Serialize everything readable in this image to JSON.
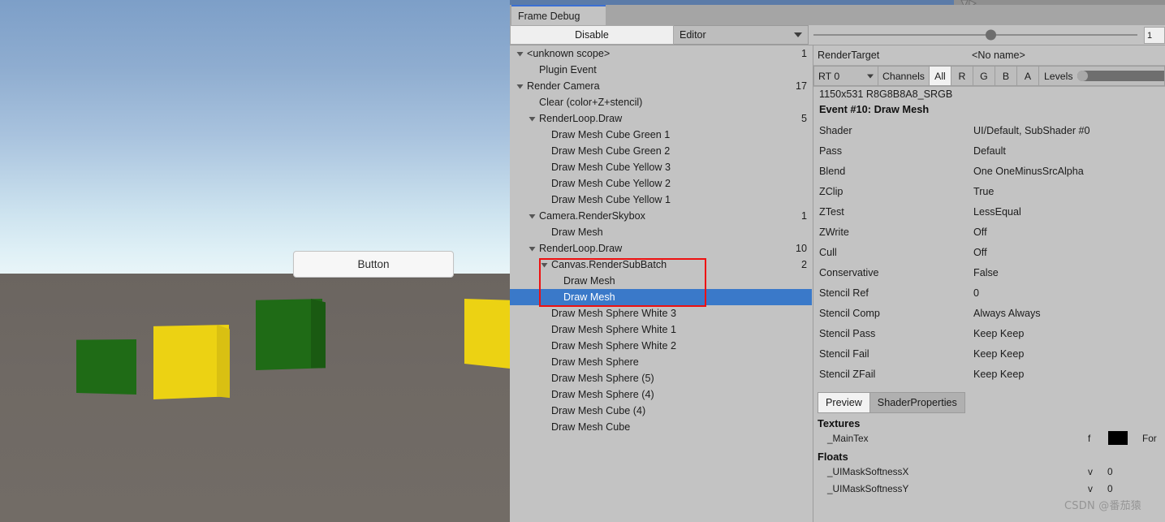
{
  "viewport": {
    "button_label": "Button"
  },
  "window": {
    "tab_label": "Frame Debug"
  },
  "toolbar": {
    "disable_label": "Disable",
    "target_dropdown": "Editor",
    "slider_value": "1"
  },
  "tree": {
    "rows": [
      {
        "label": "<unknown scope>",
        "depth": 0,
        "arrow": "down",
        "count": "1"
      },
      {
        "label": "Plugin Event",
        "depth": 1,
        "arrow": "none",
        "count": ""
      },
      {
        "label": "Render Camera",
        "depth": 0,
        "arrow": "down",
        "count": "17"
      },
      {
        "label": "Clear (color+Z+stencil)",
        "depth": 1,
        "arrow": "none",
        "count": ""
      },
      {
        "label": "RenderLoop.Draw",
        "depth": 1,
        "arrow": "down",
        "count": "5"
      },
      {
        "label": "Draw Mesh Cube Green 1",
        "depth": 2,
        "arrow": "none",
        "count": ""
      },
      {
        "label": "Draw Mesh Cube Green 2",
        "depth": 2,
        "arrow": "none",
        "count": ""
      },
      {
        "label": "Draw Mesh Cube Yellow 3",
        "depth": 2,
        "arrow": "none",
        "count": ""
      },
      {
        "label": "Draw Mesh Cube Yellow 2",
        "depth": 2,
        "arrow": "none",
        "count": ""
      },
      {
        "label": "Draw Mesh Cube Yellow 1",
        "depth": 2,
        "arrow": "none",
        "count": ""
      },
      {
        "label": "Camera.RenderSkybox",
        "depth": 1,
        "arrow": "down",
        "count": "1"
      },
      {
        "label": "Draw Mesh",
        "depth": 2,
        "arrow": "none",
        "count": ""
      },
      {
        "label": "RenderLoop.Draw",
        "depth": 1,
        "arrow": "down",
        "count": "10"
      },
      {
        "label": "Canvas.RenderSubBatch",
        "depth": 2,
        "arrow": "down",
        "count": "2"
      },
      {
        "label": "Draw Mesh",
        "depth": 3,
        "arrow": "none",
        "count": ""
      },
      {
        "label": "Draw Mesh",
        "depth": 3,
        "arrow": "none",
        "count": "",
        "selected": true
      },
      {
        "label": "Draw Mesh Sphere White 3",
        "depth": 2,
        "arrow": "none",
        "count": ""
      },
      {
        "label": "Draw Mesh Sphere White 1",
        "depth": 2,
        "arrow": "none",
        "count": ""
      },
      {
        "label": "Draw Mesh Sphere White 2",
        "depth": 2,
        "arrow": "none",
        "count": ""
      },
      {
        "label": "Draw Mesh Sphere",
        "depth": 2,
        "arrow": "none",
        "count": ""
      },
      {
        "label": "Draw Mesh Sphere (5)",
        "depth": 2,
        "arrow": "none",
        "count": ""
      },
      {
        "label": "Draw Mesh Sphere (4)",
        "depth": 2,
        "arrow": "none",
        "count": ""
      },
      {
        "label": "Draw Mesh Cube (4)",
        "depth": 2,
        "arrow": "none",
        "count": ""
      },
      {
        "label": "Draw Mesh Cube",
        "depth": 2,
        "arrow": "none",
        "count": ""
      }
    ]
  },
  "detail": {
    "render_target_label": "RenderTarget",
    "render_target_value": "<No name>",
    "rt_dropdown": "RT 0",
    "channels_label": "Channels",
    "channels": [
      "All",
      "R",
      "G",
      "B",
      "A"
    ],
    "channel_active": "All",
    "levels_label": "Levels",
    "resolution": "1150x531 R8G8B8A8_SRGB",
    "event_title": "Event #10: Draw Mesh",
    "properties": [
      {
        "key": "Shader",
        "value": "UI/Default, SubShader #0"
      },
      {
        "key": "Pass",
        "value": "Default"
      },
      {
        "key": "Blend",
        "value": "One OneMinusSrcAlpha"
      },
      {
        "key": "ZClip",
        "value": "True"
      },
      {
        "key": "ZTest",
        "value": "LessEqual"
      },
      {
        "key": "ZWrite",
        "value": "Off"
      },
      {
        "key": "Cull",
        "value": "Off"
      },
      {
        "key": "Conservative",
        "value": "False"
      },
      {
        "key": "Stencil Ref",
        "value": "0"
      },
      {
        "key": "Stencil Comp",
        "value": "Always Always"
      },
      {
        "key": "Stencil Pass",
        "value": "Keep Keep"
      },
      {
        "key": "Stencil Fail",
        "value": "Keep Keep"
      },
      {
        "key": "Stencil ZFail",
        "value": "Keep Keep"
      }
    ],
    "mini_tabs": [
      "Preview",
      "ShaderProperties"
    ],
    "mini_tab_active": "Preview",
    "textures_header": "Textures",
    "textures": [
      {
        "name": "_MainTex",
        "flag": "f",
        "tail": "For"
      }
    ],
    "floats_header": "Floats",
    "floats": [
      {
        "name": "_UIMaskSoftnessX",
        "flag": "v",
        "value": "0"
      },
      {
        "name": "_UIMaskSoftnessY",
        "flag": "v",
        "value": "0"
      }
    ]
  },
  "watermark": "CSDN @番茄猿",
  "colors": {
    "selection": "#3a79c9",
    "highlight_box": "#ee1111",
    "panel_bg": "#c3c3c3"
  }
}
